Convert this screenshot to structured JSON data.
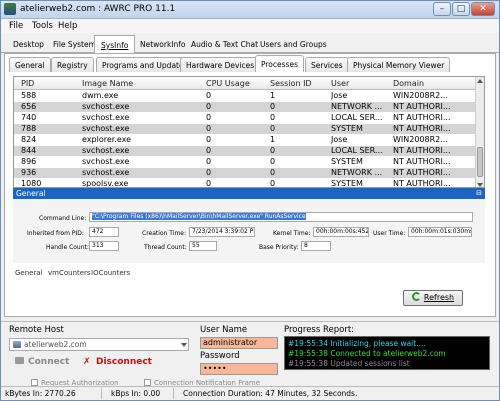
{
  "window": {
    "title": "atelierweb2.com : AWRC PRO 11.1",
    "controls": {
      "minimize": "–",
      "maximize": "□",
      "close": "✕"
    }
  },
  "menu": [
    "File",
    "Tools",
    "Help"
  ],
  "top_tabs": [
    "Desktop",
    "File System",
    "SysInfo",
    "NetworkInfo",
    "Audio & Text Chat",
    "Users and Groups"
  ],
  "sub_tabs": [
    "General",
    "Registry",
    "Programs and Updates",
    "Hardware Devices",
    "Processes",
    "Services",
    "Physical Memory Viewer"
  ],
  "process_table": {
    "columns": [
      "PID",
      "Image Name",
      "CPU Usage",
      "Session ID",
      "User",
      "Domain"
    ],
    "rows": [
      [
        "588",
        "dwm.exe",
        "0",
        "1",
        "Jose",
        "WIN2008R2..."
      ],
      [
        "656",
        "svchost.exe",
        "0",
        "0",
        "NETWORK ...",
        "NT AUTHORI..."
      ],
      [
        "740",
        "svchost.exe",
        "0",
        "0",
        "LOCAL SER...",
        "NT AUTHORI..."
      ],
      [
        "788",
        "svchost.exe",
        "0",
        "0",
        "SYSTEM",
        "NT AUTHORI..."
      ],
      [
        "824",
        "explorer.exe",
        "0",
        "1",
        "Jose",
        "WIN2008R2..."
      ],
      [
        "844",
        "svchost.exe",
        "0",
        "0",
        "LOCAL SER...",
        "NT AUTHORI..."
      ],
      [
        "896",
        "svchost.exe",
        "0",
        "0",
        "SYSTEM",
        "NT AUTHORI..."
      ],
      [
        "936",
        "svchost.exe",
        "0",
        "0",
        "NETWORK ...",
        "NT AUTHORI..."
      ],
      [
        "1080",
        "spoolsv.exe",
        "0",
        "0",
        "SYSTEM",
        "NT AUTHORI..."
      ]
    ]
  },
  "general_panel": {
    "header": "General",
    "pin": "⊟",
    "command_line_label": "Command Line:",
    "command_line_value": "\"C:\\Program Files (x86)\\hMailServer\\Bin\\hMailServer.exe\" RunAsService",
    "inherited_label": "Inherited from PID:",
    "inherited_value": "472",
    "creation_label": "Creation Time:",
    "creation_value": "7/23/2014 3:39:02 PM",
    "kernel_label": "Kernel Time:",
    "kernel_value": "00h:00m:00s:452ms",
    "user_time_label": "User Time:",
    "user_time_value": "00h:00m:01s:030ms",
    "handle_label": "Handle Count:",
    "handle_value": "313",
    "thread_label": "Thread Count:",
    "thread_value": "55",
    "priority_label": "Base Priority:",
    "priority_value": "8"
  },
  "detail_tabs": [
    "General",
    "vmCounters",
    "IOCounters"
  ],
  "refresh_label": "Refresh",
  "remote_host": {
    "label": "Remote Host",
    "value": "atelierweb2.com",
    "connect": "Connect",
    "disconnect": "Disconnect"
  },
  "credentials": {
    "user_label": "User Name",
    "user_value": "administrator",
    "password_label": "Password",
    "password_value": "•••••"
  },
  "progress": {
    "label": "Progress Report:",
    "lines": [
      {
        "text": "#19:55:34 Initializing, please wait....",
        "color": "#2fd8e8"
      },
      {
        "text": "#19:55:38 Connected to atelierweb2.com",
        "color": "#39e039"
      },
      {
        "text": "#19:55:38 Updated sessions list",
        "color": "#8a8a8a"
      }
    ]
  },
  "options": [
    "Request Authorization",
    "Connection Notification Frame"
  ],
  "status": {
    "kbytes_in": "kBytes In: 2770.26",
    "kbps_in": "kBps In: 0.00",
    "duration": "Connection Duration: 47 Minutes, 32 Seconds."
  }
}
